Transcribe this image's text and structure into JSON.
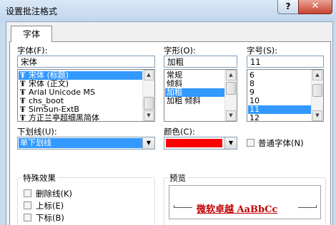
{
  "window": {
    "title": "设置批注格式",
    "help_label": "?",
    "close_label": "✕"
  },
  "tabs": [
    {
      "label": "字体"
    }
  ],
  "font": {
    "label": "字体(F):",
    "value": "宋体",
    "list": [
      {
        "name": "宋体 (标题)",
        "selected": true
      },
      {
        "name": "宋体 (正文)",
        "selected": false
      },
      {
        "name": "Arial Unicode MS",
        "selected": false
      },
      {
        "name": "chs_boot",
        "selected": false
      },
      {
        "name": "SimSun-ExtB",
        "selected": false
      },
      {
        "name": "方正兰亭超细黑简体",
        "selected": false
      }
    ],
    "icon": "truetype-font-icon",
    "icon_glyph": "Ŧ"
  },
  "style": {
    "label": "字形(O):",
    "value": "加粗",
    "list": [
      {
        "name": "常规",
        "selected": false
      },
      {
        "name": "倾斜",
        "selected": false
      },
      {
        "name": "加粗",
        "selected": true
      },
      {
        "name": "加粗 倾斜",
        "selected": false
      }
    ]
  },
  "size": {
    "label": "字号(S):",
    "value": "11",
    "list": [
      {
        "name": "6",
        "selected": false
      },
      {
        "name": "8",
        "selected": false
      },
      {
        "name": "9",
        "selected": false
      },
      {
        "name": "10",
        "selected": false
      },
      {
        "name": "11",
        "selected": true
      },
      {
        "name": "12",
        "selected": false
      }
    ]
  },
  "underline": {
    "label": "下划线(U):",
    "value": "单下划线"
  },
  "color": {
    "label": "颜色(C):",
    "value": "#ff0000"
  },
  "normal_font": {
    "label": "普通字体(N)",
    "checked": false
  },
  "effects": {
    "label": "特殊效果",
    "items": [
      {
        "label": "删除线(K)",
        "checked": false
      },
      {
        "label": "上标(E)",
        "checked": false
      },
      {
        "label": "下标(B)",
        "checked": false
      }
    ]
  },
  "preview": {
    "label": "预览",
    "sample": "微软卓越  AaBbCc"
  },
  "colors": {
    "selection": "#3399ff",
    "sample_text": "#c00000",
    "titlebar": "#c9dbef"
  }
}
